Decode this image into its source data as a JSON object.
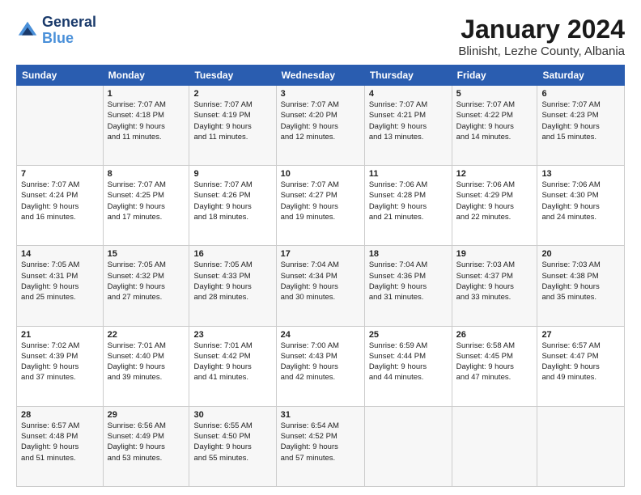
{
  "header": {
    "logo_line1": "General",
    "logo_line2": "Blue",
    "title": "January 2024",
    "subtitle": "Blinisht, Lezhe County, Albania"
  },
  "weekdays": [
    "Sunday",
    "Monday",
    "Tuesday",
    "Wednesday",
    "Thursday",
    "Friday",
    "Saturday"
  ],
  "weeks": [
    [
      {
        "day": "",
        "content": ""
      },
      {
        "day": "1",
        "content": "Sunrise: 7:07 AM\nSunset: 4:18 PM\nDaylight: 9 hours\nand 11 minutes."
      },
      {
        "day": "2",
        "content": "Sunrise: 7:07 AM\nSunset: 4:19 PM\nDaylight: 9 hours\nand 11 minutes."
      },
      {
        "day": "3",
        "content": "Sunrise: 7:07 AM\nSunset: 4:20 PM\nDaylight: 9 hours\nand 12 minutes."
      },
      {
        "day": "4",
        "content": "Sunrise: 7:07 AM\nSunset: 4:21 PM\nDaylight: 9 hours\nand 13 minutes."
      },
      {
        "day": "5",
        "content": "Sunrise: 7:07 AM\nSunset: 4:22 PM\nDaylight: 9 hours\nand 14 minutes."
      },
      {
        "day": "6",
        "content": "Sunrise: 7:07 AM\nSunset: 4:23 PM\nDaylight: 9 hours\nand 15 minutes."
      }
    ],
    [
      {
        "day": "7",
        "content": "Sunrise: 7:07 AM\nSunset: 4:24 PM\nDaylight: 9 hours\nand 16 minutes."
      },
      {
        "day": "8",
        "content": "Sunrise: 7:07 AM\nSunset: 4:25 PM\nDaylight: 9 hours\nand 17 minutes."
      },
      {
        "day": "9",
        "content": "Sunrise: 7:07 AM\nSunset: 4:26 PM\nDaylight: 9 hours\nand 18 minutes."
      },
      {
        "day": "10",
        "content": "Sunrise: 7:07 AM\nSunset: 4:27 PM\nDaylight: 9 hours\nand 19 minutes."
      },
      {
        "day": "11",
        "content": "Sunrise: 7:06 AM\nSunset: 4:28 PM\nDaylight: 9 hours\nand 21 minutes."
      },
      {
        "day": "12",
        "content": "Sunrise: 7:06 AM\nSunset: 4:29 PM\nDaylight: 9 hours\nand 22 minutes."
      },
      {
        "day": "13",
        "content": "Sunrise: 7:06 AM\nSunset: 4:30 PM\nDaylight: 9 hours\nand 24 minutes."
      }
    ],
    [
      {
        "day": "14",
        "content": "Sunrise: 7:05 AM\nSunset: 4:31 PM\nDaylight: 9 hours\nand 25 minutes."
      },
      {
        "day": "15",
        "content": "Sunrise: 7:05 AM\nSunset: 4:32 PM\nDaylight: 9 hours\nand 27 minutes."
      },
      {
        "day": "16",
        "content": "Sunrise: 7:05 AM\nSunset: 4:33 PM\nDaylight: 9 hours\nand 28 minutes."
      },
      {
        "day": "17",
        "content": "Sunrise: 7:04 AM\nSunset: 4:34 PM\nDaylight: 9 hours\nand 30 minutes."
      },
      {
        "day": "18",
        "content": "Sunrise: 7:04 AM\nSunset: 4:36 PM\nDaylight: 9 hours\nand 31 minutes."
      },
      {
        "day": "19",
        "content": "Sunrise: 7:03 AM\nSunset: 4:37 PM\nDaylight: 9 hours\nand 33 minutes."
      },
      {
        "day": "20",
        "content": "Sunrise: 7:03 AM\nSunset: 4:38 PM\nDaylight: 9 hours\nand 35 minutes."
      }
    ],
    [
      {
        "day": "21",
        "content": "Sunrise: 7:02 AM\nSunset: 4:39 PM\nDaylight: 9 hours\nand 37 minutes."
      },
      {
        "day": "22",
        "content": "Sunrise: 7:01 AM\nSunset: 4:40 PM\nDaylight: 9 hours\nand 39 minutes."
      },
      {
        "day": "23",
        "content": "Sunrise: 7:01 AM\nSunset: 4:42 PM\nDaylight: 9 hours\nand 41 minutes."
      },
      {
        "day": "24",
        "content": "Sunrise: 7:00 AM\nSunset: 4:43 PM\nDaylight: 9 hours\nand 42 minutes."
      },
      {
        "day": "25",
        "content": "Sunrise: 6:59 AM\nSunset: 4:44 PM\nDaylight: 9 hours\nand 44 minutes."
      },
      {
        "day": "26",
        "content": "Sunrise: 6:58 AM\nSunset: 4:45 PM\nDaylight: 9 hours\nand 47 minutes."
      },
      {
        "day": "27",
        "content": "Sunrise: 6:57 AM\nSunset: 4:47 PM\nDaylight: 9 hours\nand 49 minutes."
      }
    ],
    [
      {
        "day": "28",
        "content": "Sunrise: 6:57 AM\nSunset: 4:48 PM\nDaylight: 9 hours\nand 51 minutes."
      },
      {
        "day": "29",
        "content": "Sunrise: 6:56 AM\nSunset: 4:49 PM\nDaylight: 9 hours\nand 53 minutes."
      },
      {
        "day": "30",
        "content": "Sunrise: 6:55 AM\nSunset: 4:50 PM\nDaylight: 9 hours\nand 55 minutes."
      },
      {
        "day": "31",
        "content": "Sunrise: 6:54 AM\nSunset: 4:52 PM\nDaylight: 9 hours\nand 57 minutes."
      },
      {
        "day": "",
        "content": ""
      },
      {
        "day": "",
        "content": ""
      },
      {
        "day": "",
        "content": ""
      }
    ]
  ]
}
